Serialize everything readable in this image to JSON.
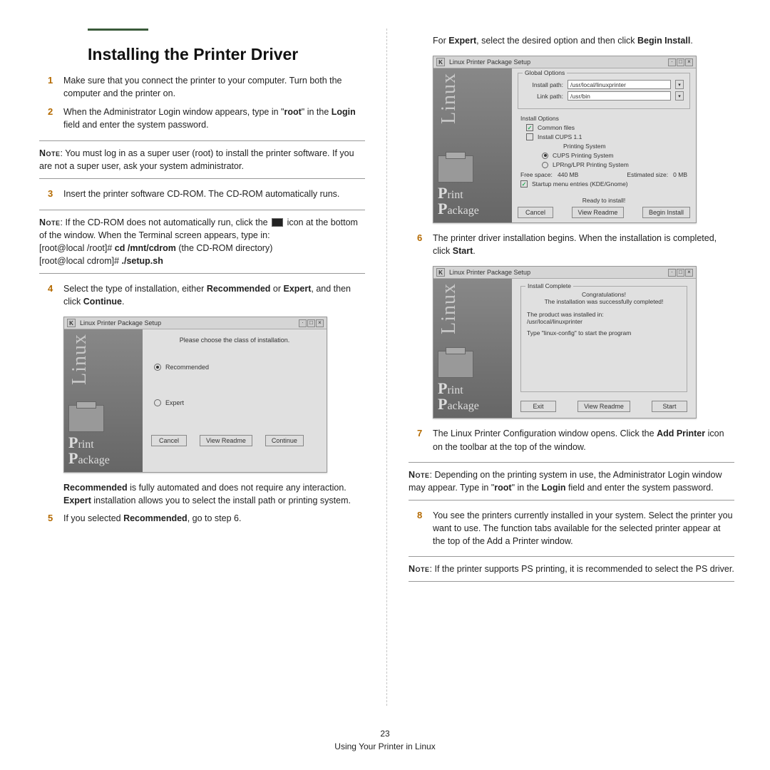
{
  "title": "Installing the Printer Driver",
  "steps": {
    "1": "Make sure that you connect the printer to your computer. Turn both the computer and the printer on.",
    "2_pre": "When the Administrator Login window appears, type in \"",
    "2_root": "root",
    "2_mid": "\" in the ",
    "2_login": "Login",
    "2_post": " field and enter the system password.",
    "3": "Insert the printer software CD-ROM. The CD-ROM automatically runs.",
    "4_pre": "Select the type of installation, either ",
    "4_rec": "Recommended",
    "4_mid": " or ",
    "4_exp": "Expert",
    "4_mid2": ", and then click ",
    "4_cont": "Continue",
    "4_post": ".",
    "4b_rec": "Recommended",
    "4b_mid": " is fully automated and does not require any interaction. ",
    "4b_exp": "Expert",
    "4b_post": " installation allows you to select the install path or printing system.",
    "5_pre": "If you selected ",
    "5_rec": "Recommended",
    "5_post": ", go to step 6.",
    "6_pre": "The printer driver installation begins. When the installation is completed, click ",
    "6_start": "Start",
    "6_post": ".",
    "7_pre": "The Linux Printer Configuration window opens. Click the ",
    "7_add": "Add Printer",
    "7_post": " icon on the toolbar at the top of the window.",
    "8": "You see the printers currently installed in your system. Select the printer you want to use. The function tabs available for the selected printer appear at the top of the Add a Printer window.",
    "rtop_pre": "For ",
    "rtop_exp": "Expert",
    "rtop_mid": ", select the desired option and then click ",
    "rtop_begin": "Begin Install",
    "rtop_post": "."
  },
  "notes": {
    "n1": ": You must log in as a super user (root) to install the printer software. If you are not a super user, ask your system administrator.",
    "n2a": ": If the CD-ROM does not automatically run, click the ",
    "n2b": " icon at the bottom of the window. When the Terminal screen appears, type in:",
    "n2c": "[root@local /root]# ",
    "n2c_cmd": "cd /mnt/cdrom",
    "n2c_post": " (the CD-ROM directory)",
    "n2d": "[root@local cdrom]# ",
    "n2d_cmd": "./setup.sh",
    "n3_pre": ": Depending on the printing system in use, the Administrator Login window may appear. Type in \"",
    "n3_root": "root",
    "n3_mid": "\" in the ",
    "n3_login": "Login",
    "n3_post": " field and enter the system password.",
    "n4": ": If the printer supports PS printing, it is recommended to select the PS driver."
  },
  "note_label": "Note",
  "shot1": {
    "title": "Linux Printer Package Setup",
    "prompt": "Please choose the class of installation.",
    "opt1": "Recommended",
    "opt2": "Expert",
    "btn_cancel": "Cancel",
    "btn_readme": "View Readme",
    "btn_continue": "Continue"
  },
  "shot2": {
    "title": "Linux Printer Package Setup",
    "global_legend": "Global Options",
    "install_path_lbl": "Install path:",
    "install_path": "/usr/local/linuxprinter",
    "link_path_lbl": "Link path:",
    "link_path": "/usr/bin",
    "install_legend": "Install Options",
    "common": "Common files",
    "cups11": "Install CUPS 1.1",
    "ps_legend": "Printing System",
    "cups": "CUPS Printing System",
    "lpr": "LPRng/LPR Printing System",
    "free_lbl": "Free space:",
    "free": "440 MB",
    "est_lbl": "Estimated size:",
    "est": "0 MB",
    "startup": "Startup menu entries (KDE/Gnome)",
    "ready": "Ready to install!",
    "btn_cancel": "Cancel",
    "btn_readme": "View Readme",
    "btn_begin": "Begin Install"
  },
  "shot3": {
    "title": "Linux Printer Package Setup",
    "legend": "Install Complete",
    "congrats": "Congratulations!",
    "done": "The installation was successfully completed!",
    "prod1": "The product was installed in:",
    "prod2": "/usr/local/linuxprinter",
    "type": "Type \"linux-config\" to start the program",
    "btn_exit": "Exit",
    "btn_readme": "View Readme",
    "btn_start": "Start"
  },
  "footer": {
    "page": "23",
    "section": "Using Your Printer in Linux"
  },
  "sidebar": {
    "linux": "Linux",
    "print": "rint",
    "package": "ackage"
  }
}
